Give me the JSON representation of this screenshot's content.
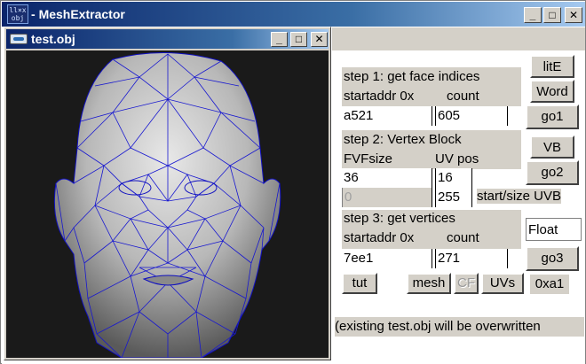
{
  "app": {
    "title": "MeshExtractor",
    "icon_text_top": "ll×x",
    "icon_text_bottom": "obj"
  },
  "caption_buttons": {
    "minimize": "_",
    "maximize": "□",
    "close": "✕"
  },
  "child_window": {
    "title": "test.obj"
  },
  "step1": {
    "title": "step 1: get face indices",
    "startaddr_label": "startaddr 0x",
    "count_label": "count",
    "startaddr_value": "a521",
    "count_value": "605"
  },
  "step2": {
    "title": "step 2: Vertex Block",
    "fvf_label": "FVFsize",
    "uvpos_label": "UV pos",
    "fvf_value": "36",
    "uvpos_value": "16",
    "start_value": "0",
    "size_value": "255",
    "startsize_label": "start/size UVB"
  },
  "step3": {
    "title": "step 3: get vertices",
    "startaddr_label": "startaddr 0x",
    "count_label": "count",
    "startaddr_value": "7ee1",
    "count_value": "271"
  },
  "buttons": {
    "lite": "litE",
    "word": "Word",
    "go1": "go1",
    "vb": "VB",
    "go2": "go2",
    "float": "Float",
    "go3": "go3",
    "tut": "tut",
    "mesh": "mesh",
    "cf": "CF",
    "uvs": "UVs",
    "hex": "0xa1"
  },
  "status": "(existing test.obj will be overwritten"
}
